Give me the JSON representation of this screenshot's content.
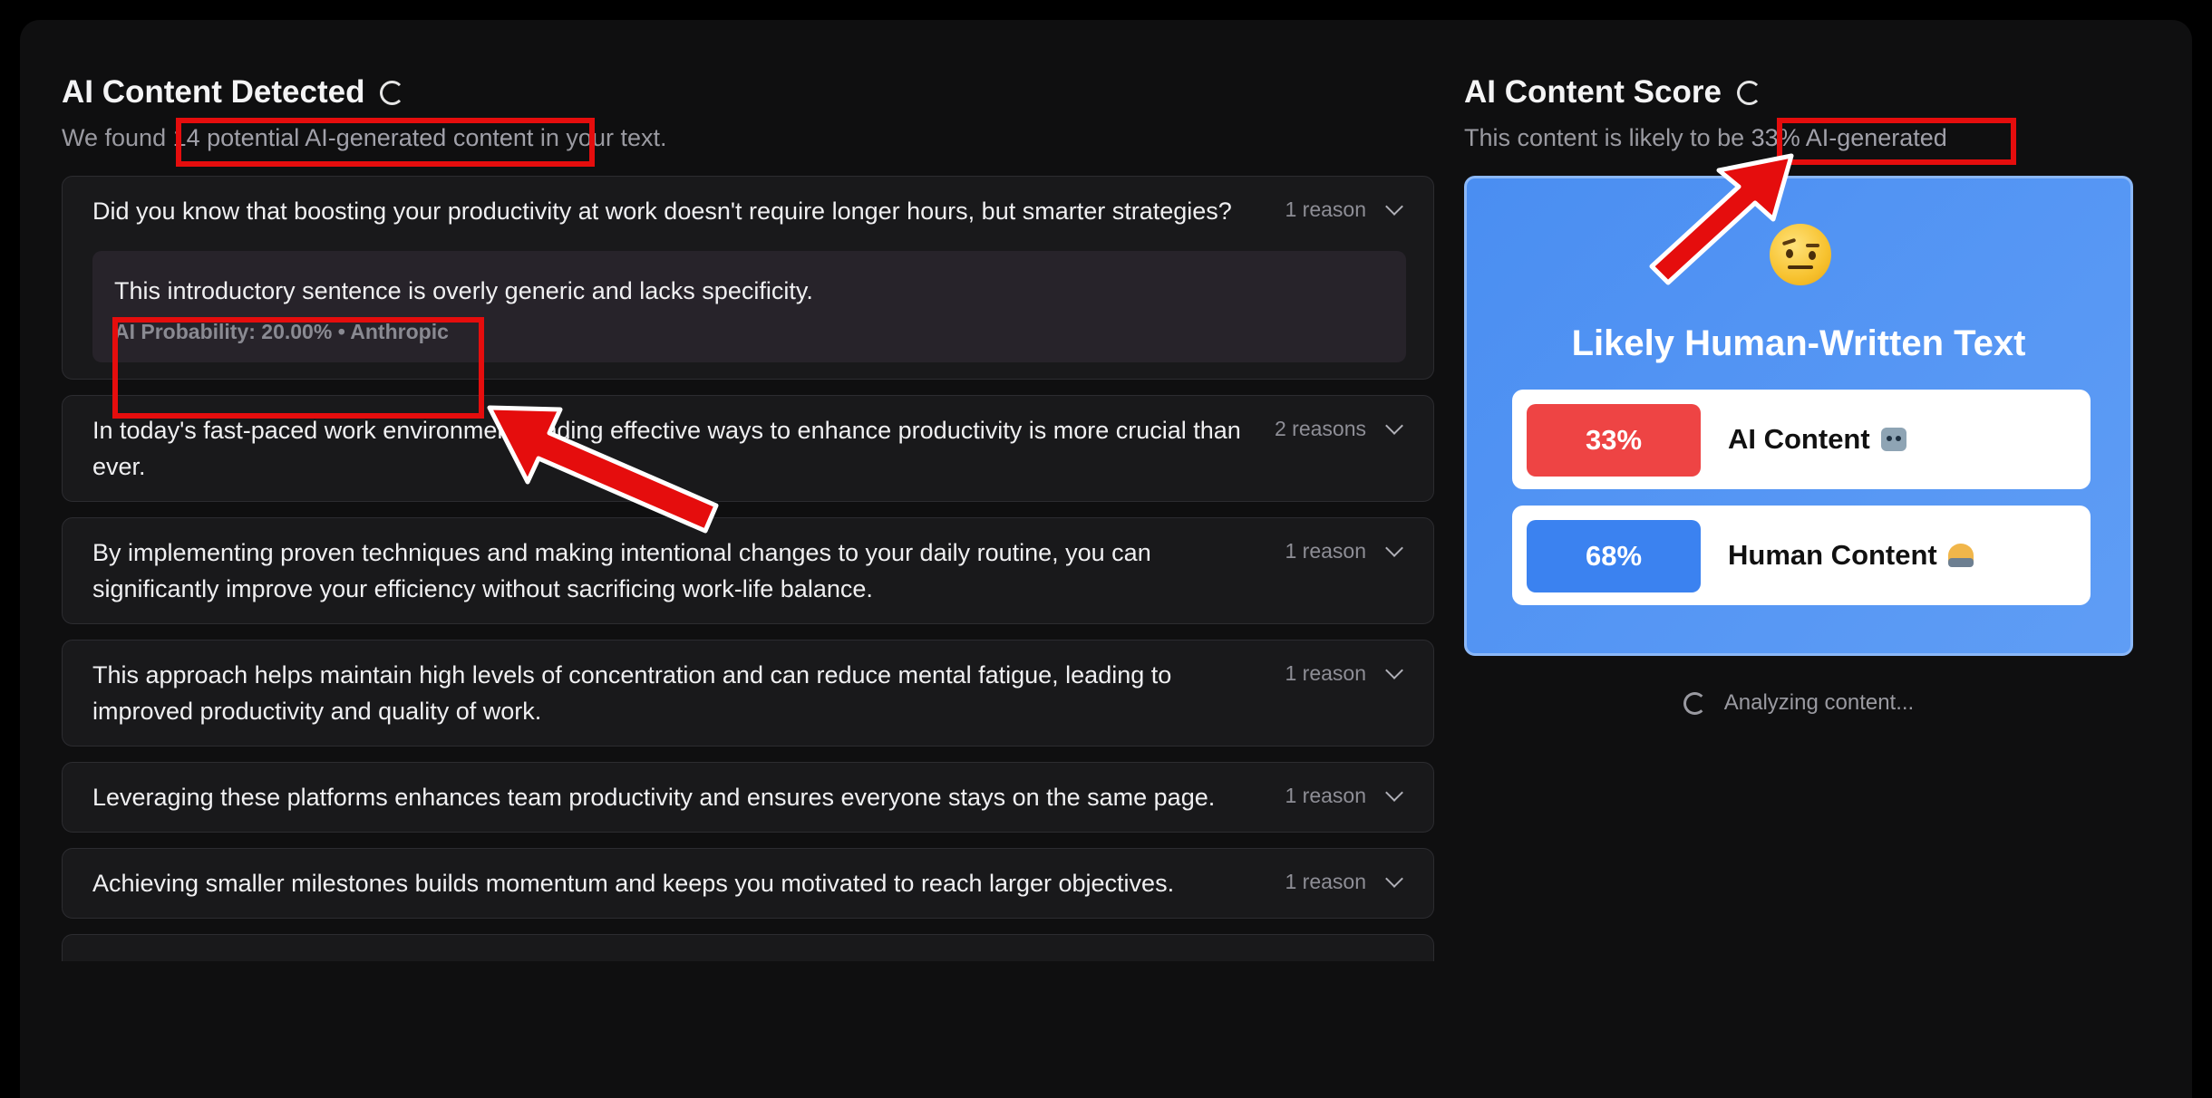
{
  "left": {
    "title": "AI Content Detected",
    "subtitle_prefix": "We found ",
    "subtitle_highlight": "14 potential AI-generated content",
    "subtitle_suffix": " in your text."
  },
  "sentences": [
    {
      "text": "Did you know that boosting your productivity at work doesn't require longer hours, but smarter strategies?",
      "reasons": "1 reason",
      "expanded": true,
      "detail_text": "This introductory sentence is overly generic and lacks specificity.",
      "detail_meta": "AI Probability: 20.00% • Anthropic"
    },
    {
      "text": "In today's fast-paced work environment, finding effective ways to enhance productivity is more crucial than ever.",
      "reasons": "2 reasons"
    },
    {
      "text": "By implementing proven techniques and making intentional changes to your daily routine, you can significantly improve your efficiency without sacrificing work-life balance.",
      "reasons": "1 reason"
    },
    {
      "text": "This approach helps maintain high levels of concentration and can reduce mental fatigue, leading to improved productivity and quality of work.",
      "reasons": "1 reason"
    },
    {
      "text": "Leveraging these platforms enhances team productivity and ensures everyone stays on the same page.",
      "reasons": "1 reason"
    },
    {
      "text": "Achieving smaller milestones builds momentum and keeps you motivated to reach larger objectives.",
      "reasons": "1 reason"
    }
  ],
  "right": {
    "title": "AI Content Score",
    "subtitle_prefix": "This content is likely to be ",
    "subtitle_highlight": "33% AI-generated",
    "verdict": "Likely Human-Written Text",
    "emoji": "face-with-raised-eyebrow-icon",
    "ai_percent": "33%",
    "ai_label": "AI Content",
    "human_percent": "68%",
    "human_label": "Human Content",
    "analyzing": "Analyzing content..."
  },
  "colors": {
    "background": "#0f0f10",
    "card": "#19191b",
    "score_blue": "#4a8ef2",
    "ai_red": "#ee4444",
    "human_blue": "#3b82f0",
    "annotation_red": "#e50d0d"
  }
}
